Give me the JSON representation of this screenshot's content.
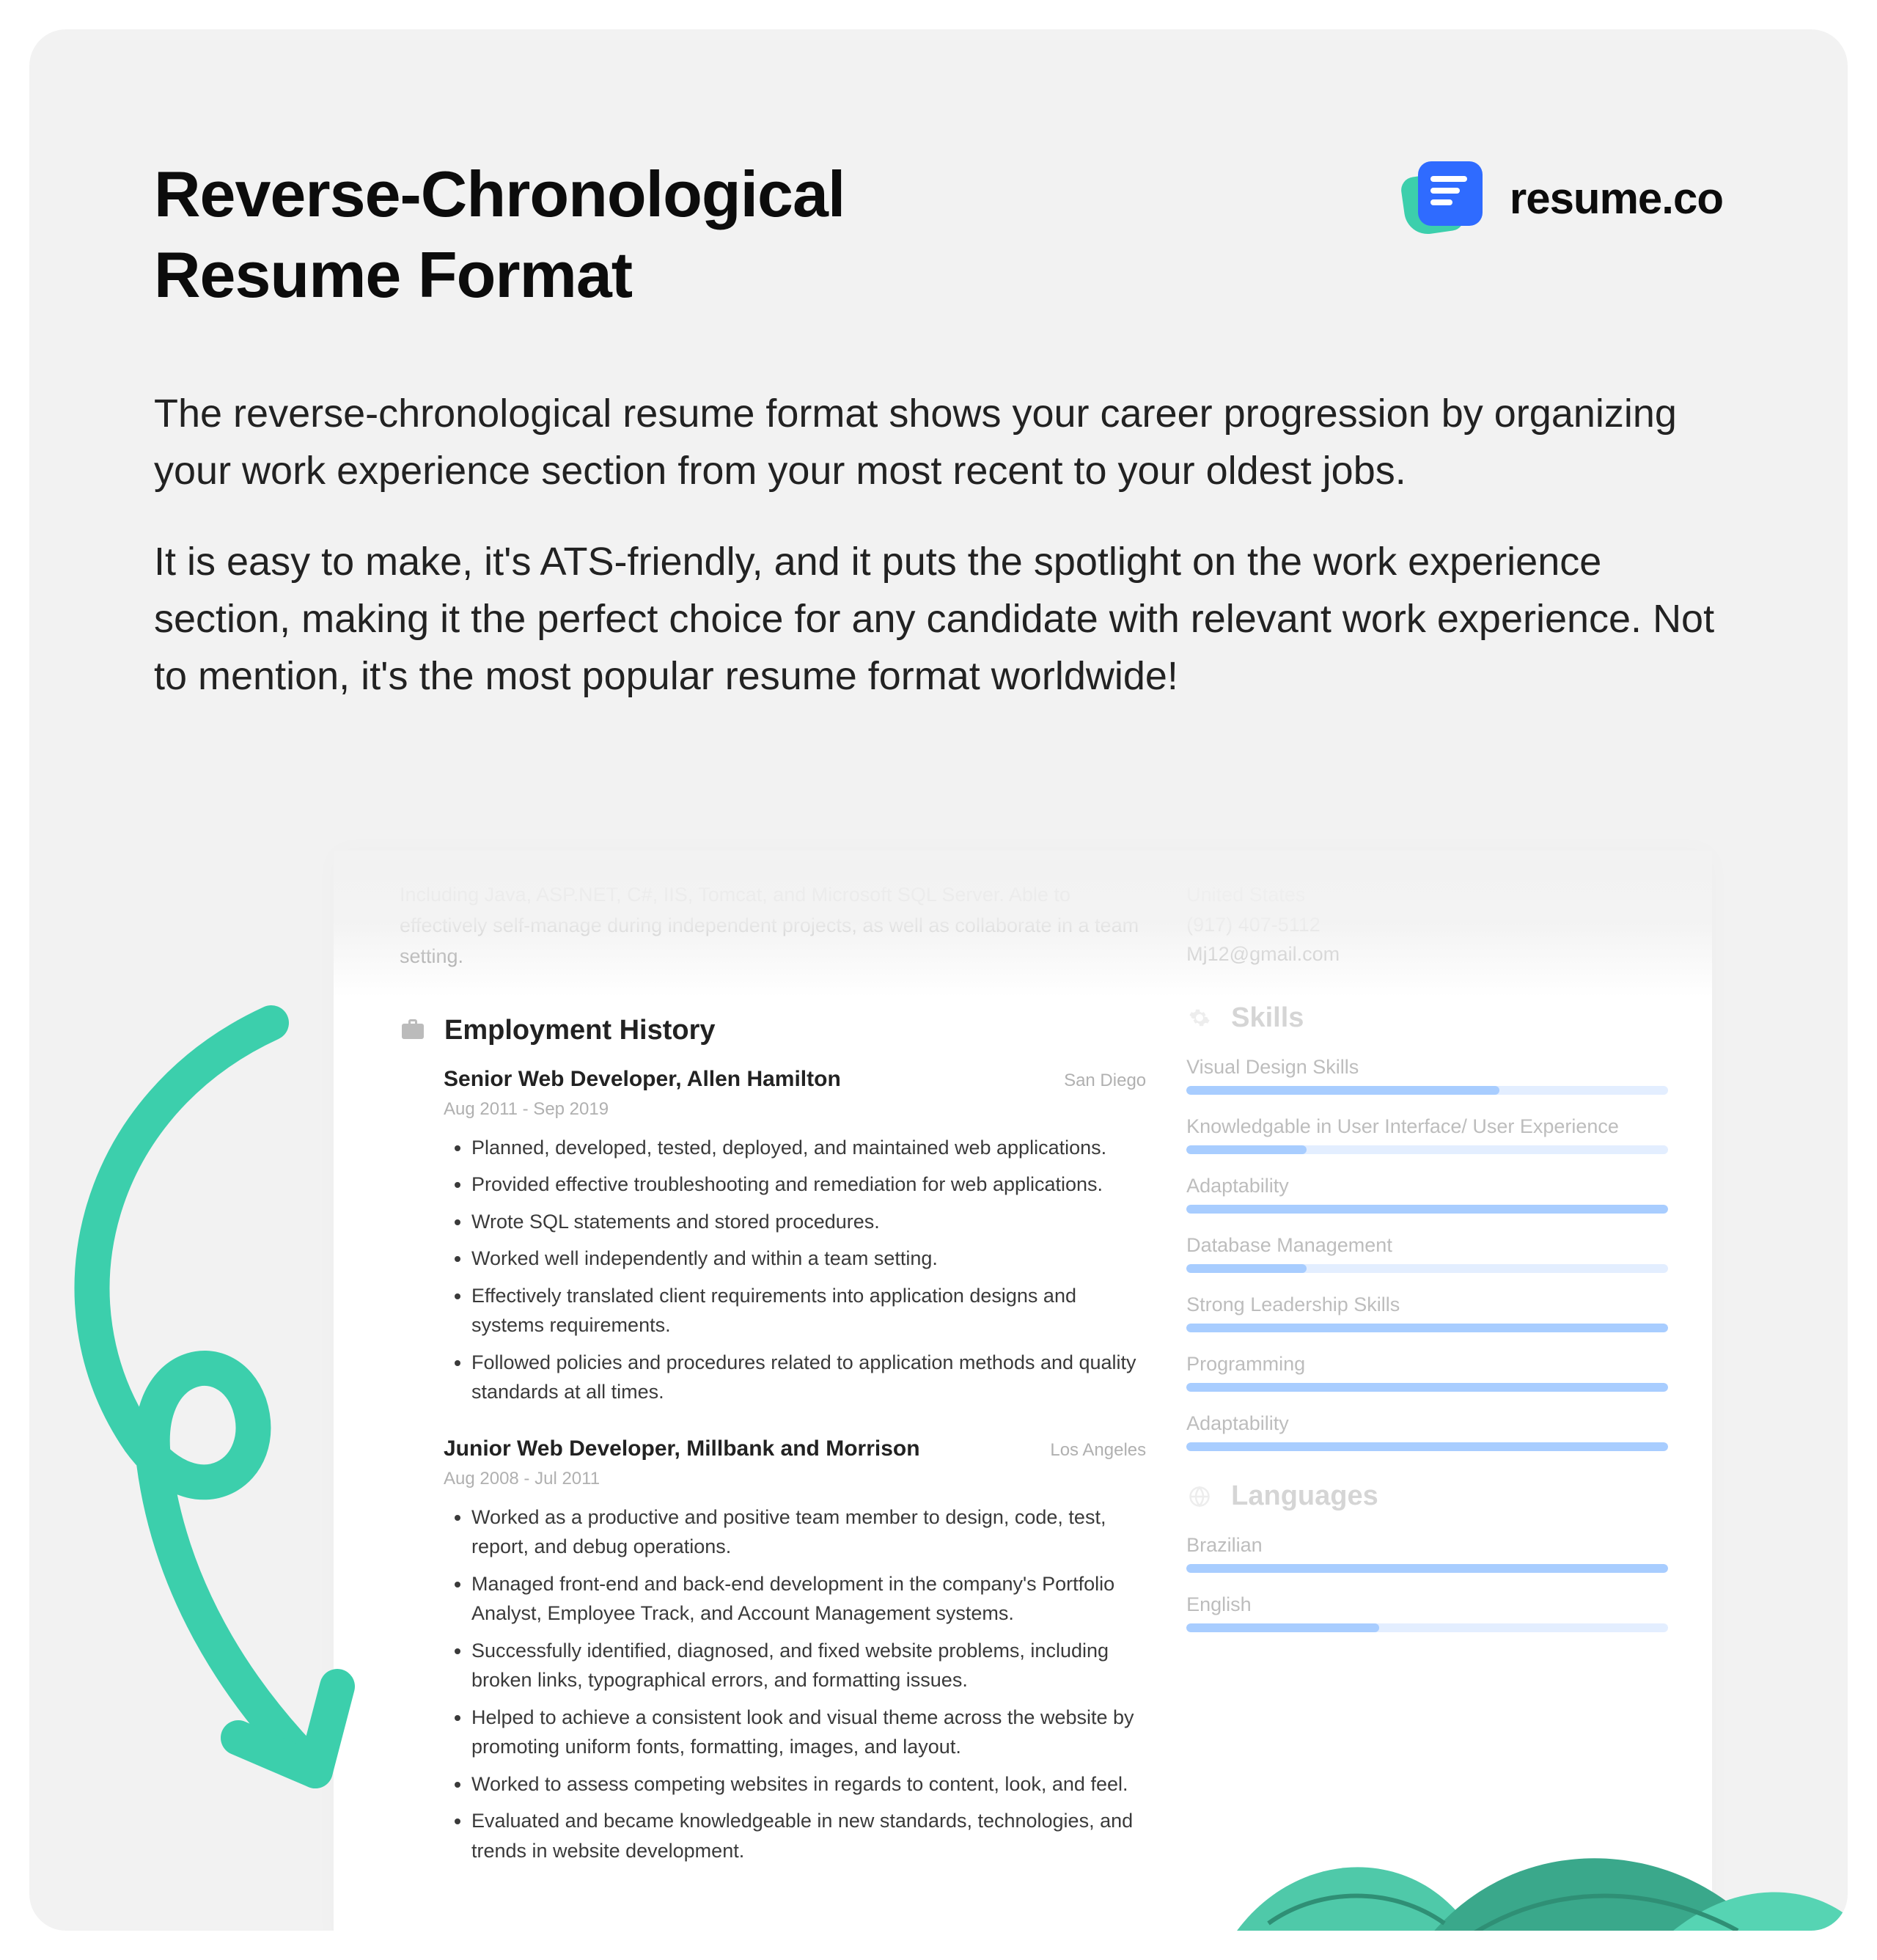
{
  "header": {
    "title_line1": "Reverse-Chronological",
    "title_line2": "Resume Format",
    "brand": "resume.co"
  },
  "intro": {
    "p1": "The reverse-chronological resume format shows your career progression by organizing your work experience section from your most recent to your oldest jobs.",
    "p2": "It is easy to make, it's ATS-friendly, and it puts the spotlight on the work experience section, making it the perfect choice for any candidate with relevant work experience. Not to mention, it's the most popular resume format worldwide!"
  },
  "resume": {
    "profile_faded": "Including Java, ASP.NET, C#, IIS, Tomcat, and Microsoft SQL Server. Able to effectively self-manage during independent projects, as well as collaborate in a team setting.",
    "contact": {
      "country": "United States",
      "phone": "(917) 407-5112",
      "email": "Mj12@gmail.com"
    },
    "employment": {
      "heading": "Employment History",
      "jobs": [
        {
          "title": "Senior Web Developer, Allen Hamilton",
          "location": "San Diego",
          "dates": "Aug 2011 - Sep 2019",
          "bullets": [
            "Planned, developed, tested, deployed, and maintained web applications.",
            "Provided effective troubleshooting and remediation for web applications.",
            "Wrote SQL statements and stored procedures.",
            "Worked well independently and within a team setting.",
            "Effectively translated client requirements into application designs and systems requirements.",
            "Followed policies and procedures related to application methods and quality standards at all times."
          ]
        },
        {
          "title": "Junior Web Developer, Millbank and Morrison",
          "location": "Los Angeles",
          "dates": "Aug 2008 - Jul 2011",
          "bullets": [
            "Worked as a productive and positive team member to design, code, test, report, and debug operations.",
            "Managed front-end and back-end development in the company's Portfolio Analyst, Employee Track, and Account Management systems.",
            "Successfully identified, diagnosed, and fixed website problems, including broken links, typographical errors, and formatting issues.",
            "Helped to achieve a consistent look and visual theme across the website by promoting uniform fonts, formatting, images, and layout.",
            "Worked to assess competing websites in regards to content, look, and feel.",
            "Evaluated and became knowledgeable in new standards, technologies, and trends in website development."
          ]
        }
      ]
    },
    "skills": {
      "heading": "Skills",
      "items": [
        {
          "label": "Visual Design Skills",
          "pct": 65
        },
        {
          "label": "Knowledgable in User Interface/ User Experience",
          "pct": 25
        },
        {
          "label": "Adaptability",
          "pct": 100
        },
        {
          "label": "Database Management",
          "pct": 25
        },
        {
          "label": "Strong Leadership Skills",
          "pct": 100
        },
        {
          "label": "Programming",
          "pct": 100
        },
        {
          "label": "Adaptability",
          "pct": 100
        }
      ]
    },
    "languages": {
      "heading": "Languages",
      "items": [
        {
          "label": "Brazilian",
          "pct": 100
        },
        {
          "label": "English",
          "pct": 40
        }
      ]
    }
  },
  "colors": {
    "accent_teal": "#3ccfac",
    "accent_blue": "#2f6bff",
    "bar_bg": "#e3eeff",
    "bar_fill": "#a8cdff"
  }
}
